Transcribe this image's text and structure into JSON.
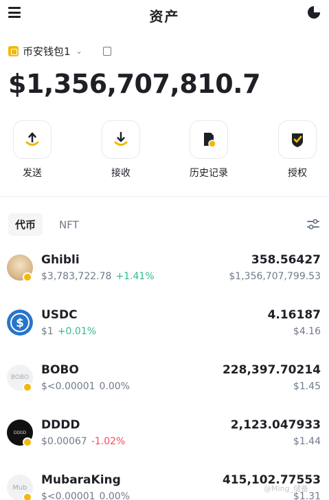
{
  "header": {
    "title": "资产"
  },
  "wallet": {
    "name": "币安钱包1",
    "balance": "$1,356,707,810.7"
  },
  "actions": [
    {
      "label": "发送",
      "icon": "send-icon"
    },
    {
      "label": "接收",
      "icon": "receive-icon"
    },
    {
      "label": "历史记录",
      "icon": "history-icon"
    },
    {
      "label": "授权",
      "icon": "approval-icon"
    }
  ],
  "tabs": [
    {
      "label": "代币"
    },
    {
      "label": "NFT"
    }
  ],
  "tokens": [
    {
      "symbol": "Ghibli",
      "price": "$3,783,722.78",
      "change": "+1.41%",
      "amount": "358.56427",
      "value": "$1,356,707,799.53",
      "avatar_label": ""
    },
    {
      "symbol": "USDC",
      "price": "$1",
      "change": "+0.01%",
      "amount": "4.16187",
      "value": "$4.16",
      "avatar_label": ""
    },
    {
      "symbol": "BOBO",
      "price": "$<0.00001",
      "change": "0.00%",
      "amount": "228,397.70214",
      "value": "$1.45",
      "avatar_label": "BOBO"
    },
    {
      "symbol": "DDDD",
      "price": "$0.00067",
      "change": "-1.02%",
      "amount": "2,123.047933",
      "value": "$1.44",
      "avatar_label": "DDDD"
    },
    {
      "symbol": "MubaraKing",
      "price": "$<0.00001",
      "change": "0.00%",
      "amount": "415,102.77553",
      "value": "$1.31",
      "avatar_label": "Mub"
    }
  ],
  "watermark": "@Ming_储备",
  "colors": {
    "accent": "#f0b90b",
    "up": "#2ebd85",
    "down": "#f6465d",
    "muted": "#707a8a"
  }
}
